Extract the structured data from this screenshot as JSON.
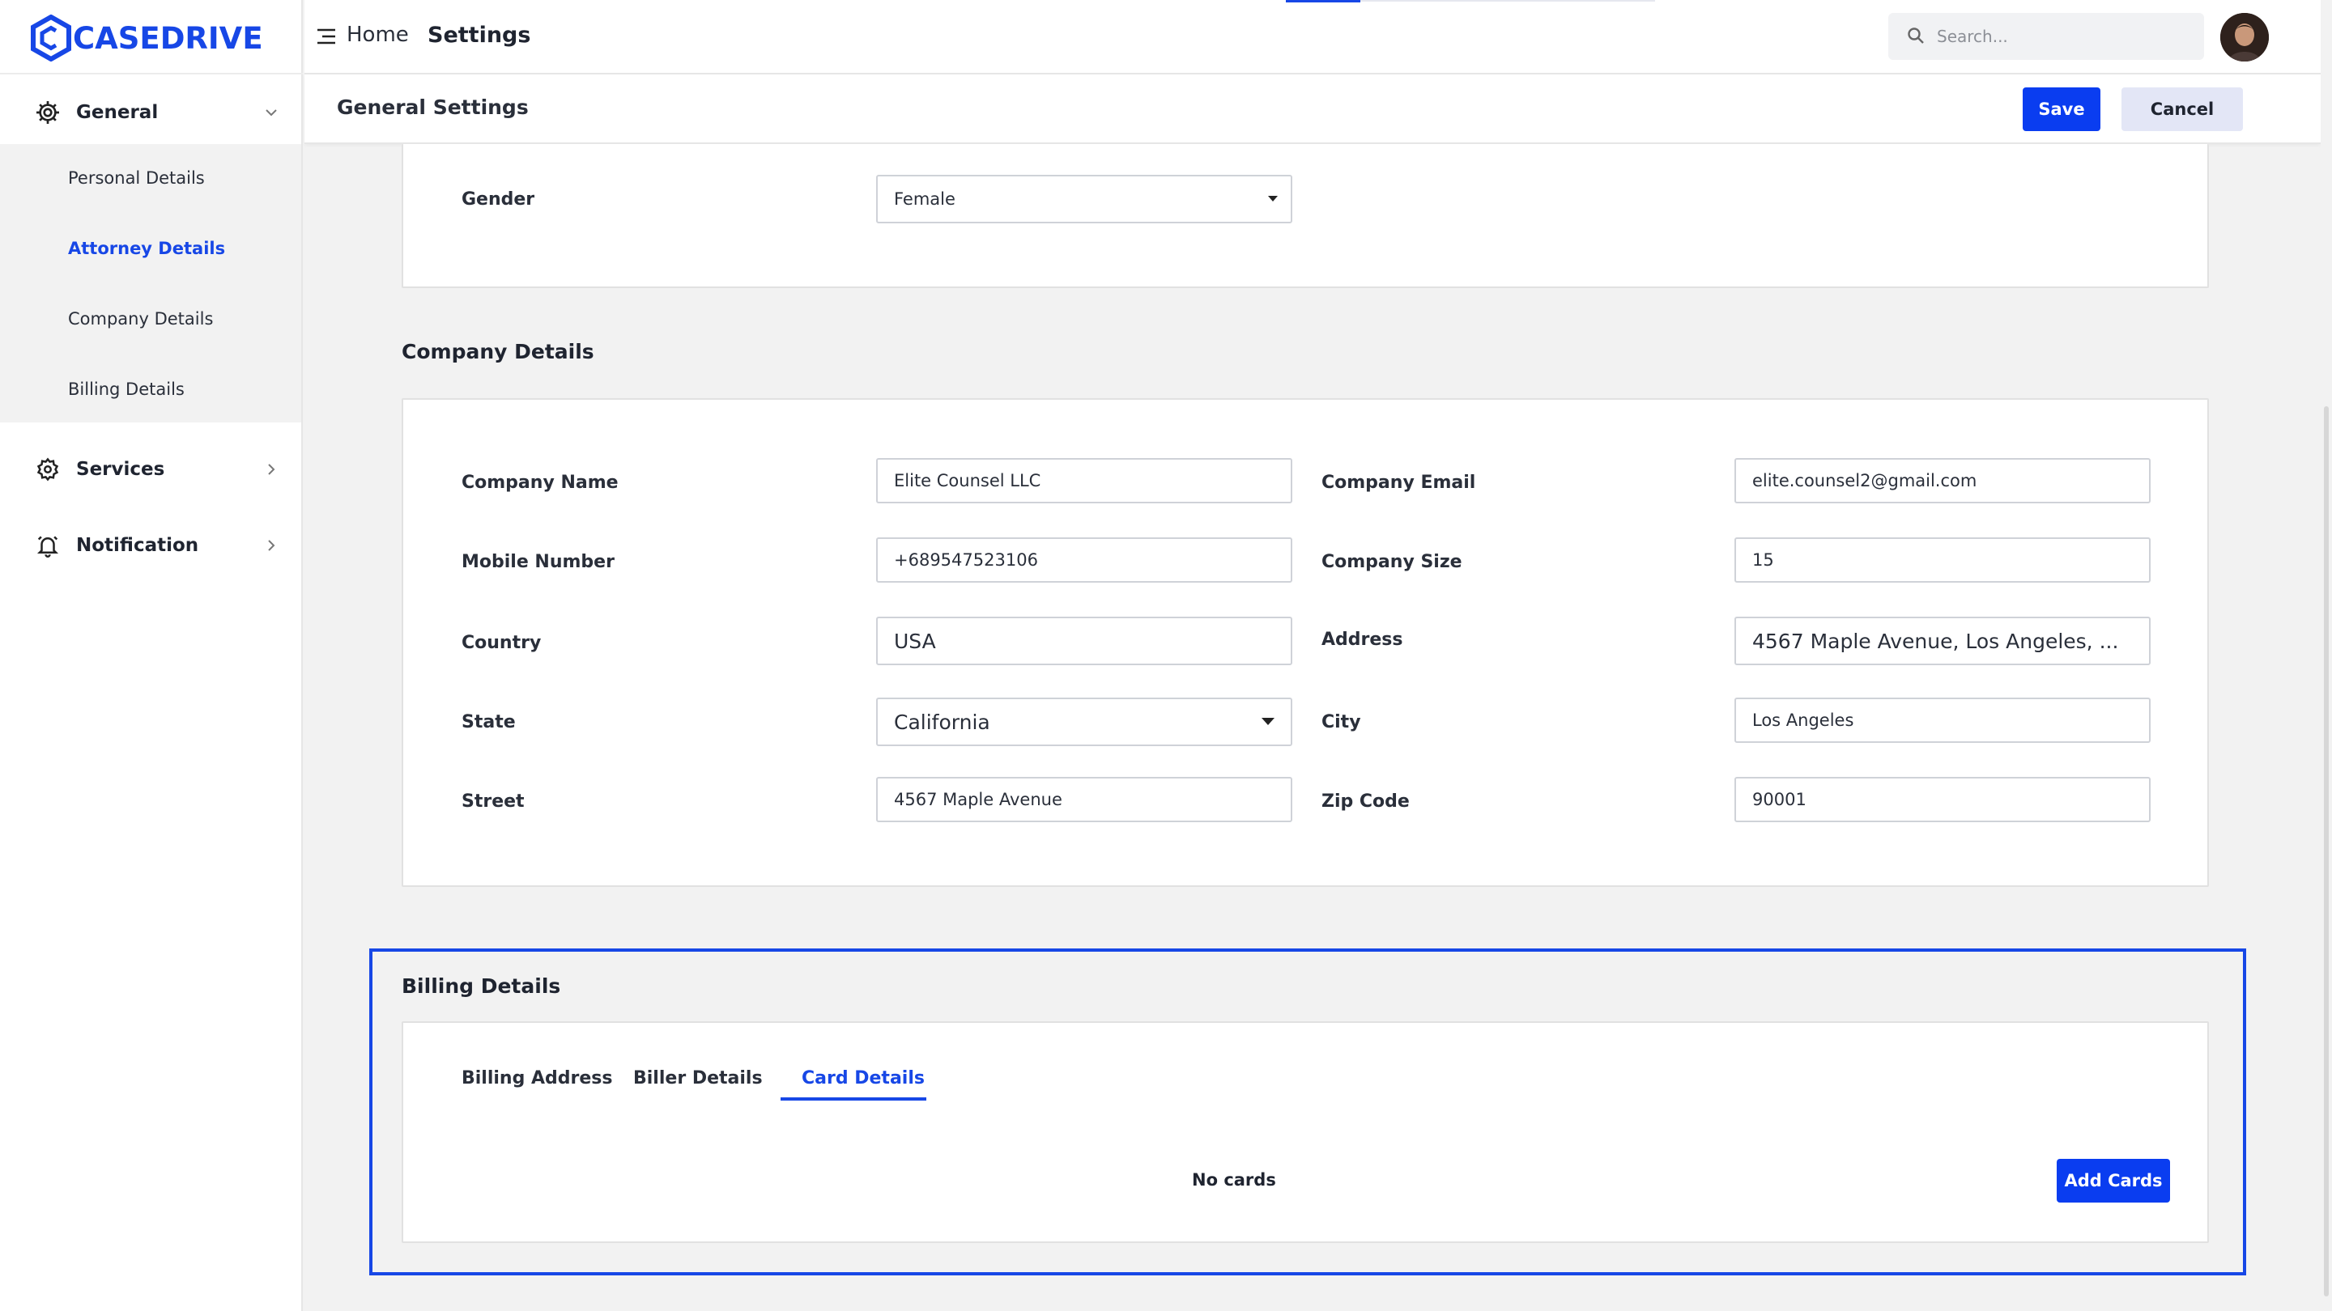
{
  "app": {
    "brand": "CASEDRIVE",
    "accent_color": "#1747e6"
  },
  "sidebar": {
    "general": {
      "label": "General",
      "icon": "gear-icon",
      "expanded": true
    },
    "submenu": [
      {
        "label": "Personal Details",
        "active": false
      },
      {
        "label": "Attorney Details",
        "active": true
      },
      {
        "label": "Company Details",
        "active": false
      },
      {
        "label": "Billing Details",
        "active": false
      }
    ],
    "services": {
      "label": "Services",
      "icon": "settings-cog-icon"
    },
    "notification": {
      "label": "Notification",
      "icon": "bell-icon"
    }
  },
  "topbar": {
    "breadcrumb_home": "Home",
    "breadcrumb_current": "Settings",
    "search_placeholder": "Search..."
  },
  "subheader": {
    "title": "General Settings",
    "save_label": "Save",
    "cancel_label": "Cancel"
  },
  "gender_section": {
    "label": "Gender",
    "value": "Female"
  },
  "company": {
    "title": "Company Details",
    "fields": {
      "company_name": {
        "label": "Company Name",
        "value": "Elite Counsel LLC"
      },
      "company_email": {
        "label": "Company Email",
        "value": "elite.counsel2@gmail.com"
      },
      "mobile_number": {
        "label": "Mobile Number",
        "value": "+689547523106"
      },
      "company_size": {
        "label": "Company Size",
        "value": "15"
      },
      "country": {
        "label": "Country",
        "value": "USA"
      },
      "address": {
        "label": "Address",
        "value": "4567 Maple Avenue, Los Angeles, ..."
      },
      "state": {
        "label": "State",
        "value": "California"
      },
      "city": {
        "label": "City",
        "value": "Los Angeles"
      },
      "street": {
        "label": "Street",
        "value": "4567 Maple Avenue"
      },
      "zip_code": {
        "label": "Zip Code",
        "value": "90001"
      }
    }
  },
  "billing": {
    "title": "Billing Details",
    "tabs": [
      {
        "label": "Billing Address",
        "active": false
      },
      {
        "label": "Biller Details",
        "active": false
      },
      {
        "label": "Card Details",
        "active": true
      }
    ],
    "empty_text": "No cards",
    "add_label": "Add Cards"
  }
}
